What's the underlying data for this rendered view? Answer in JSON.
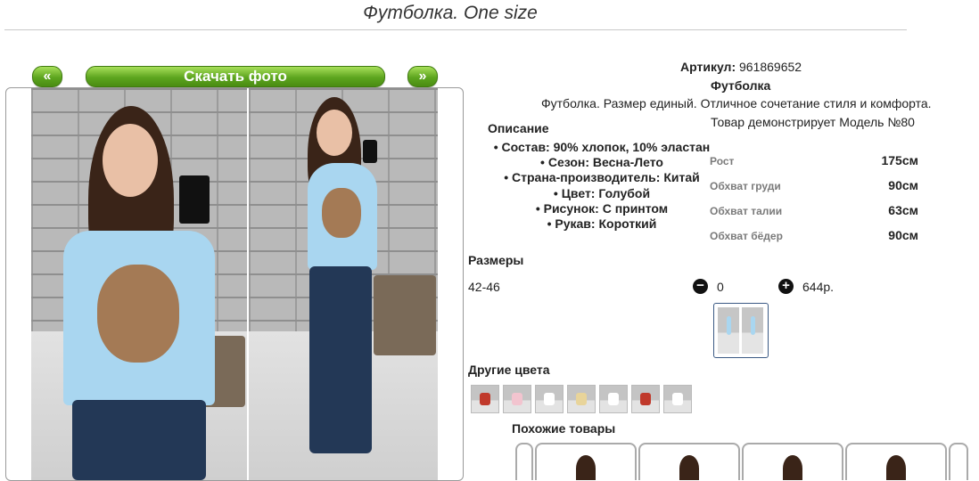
{
  "page": {
    "title": "Футболка. One size"
  },
  "gallery": {
    "prev_label": "«",
    "download_label": "Скачать фото",
    "next_label": "»"
  },
  "product": {
    "article_label": "Артикул:",
    "article_value": "961869652",
    "name": "Футболка",
    "short_description": "Футболка. Размер единый. Отличное сочетание стиля и комфорта.",
    "model_line": "Товар демонстрирует Модель №80"
  },
  "description": {
    "title": "Описание",
    "items": [
      "Состав: 90% хлопок, 10% эластан",
      "Сезон: Весна-Лето",
      "Страна-производитель: Китай",
      "Цвет: Голубой",
      "Рисунок: С принтом",
      "Рукав: Короткий"
    ]
  },
  "model_measures": [
    {
      "label": "Рост",
      "value": "175см"
    },
    {
      "label": "Обхват груди",
      "value": "90см"
    },
    {
      "label": "Обхват талии",
      "value": "63см"
    },
    {
      "label": "Обхват бёдер",
      "value": "90см"
    }
  ],
  "sizes": {
    "title": "Размеры",
    "rows": [
      {
        "size": "42-46",
        "minus_icon": "minus-icon",
        "quantity": "0",
        "plus_icon": "plus-icon",
        "price": "644р."
      }
    ]
  },
  "other_colors": {
    "title": "Другие цвета",
    "shirt_colors": [
      "#c0392b",
      "#f2c4cf",
      "#ffffff",
      "#e8d49a",
      "#ffffff",
      "#c0392b",
      "#ffffff"
    ]
  },
  "similar": {
    "title": "Похожие товары"
  },
  "colors": {
    "button_green": "#5da51f",
    "shirt_blue": "#a9d6f0",
    "thumb_border": "#3b5a84"
  }
}
